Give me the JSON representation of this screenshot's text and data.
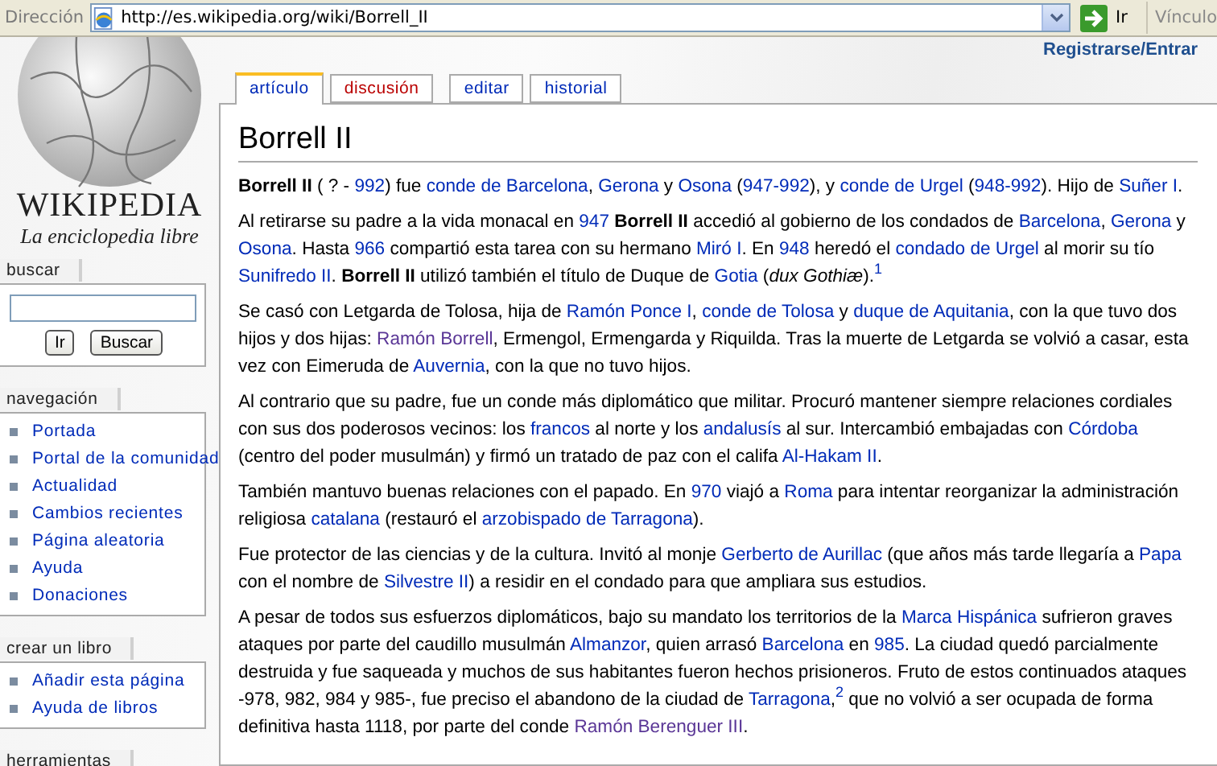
{
  "address_bar": {
    "label": "Dirección",
    "url": "http://es.wikipedia.org/wiki/Borrell_II",
    "go": "Ir",
    "links": "Vínculo"
  },
  "logo": {
    "wordmark": "WIKIPEDIA",
    "tagline": "La enciclopedia libre"
  },
  "user_link": "Registrarse/Entrar",
  "tabs": [
    {
      "label": "artículo",
      "selected": true,
      "missing": false
    },
    {
      "label": "discusión",
      "selected": false,
      "missing": true
    },
    {
      "label": "editar",
      "selected": false,
      "missing": false
    },
    {
      "label": "historial",
      "selected": false,
      "missing": false
    }
  ],
  "search": {
    "title": "buscar",
    "buttons": [
      "Ir",
      "Buscar"
    ]
  },
  "portlets": [
    {
      "title": "navegación",
      "items": [
        "Portada",
        "Portal de la comunidad",
        "Actualidad",
        "Cambios recientes",
        "Página aleatoria",
        "Ayuda",
        "Donaciones"
      ]
    },
    {
      "title": "crear un libro",
      "items": [
        "Añadir esta página",
        "Ayuda de libros"
      ]
    },
    {
      "title": "herramientas"
    }
  ],
  "article": {
    "title": "Borrell II",
    "paragraphs": [
      [
        {
          "kind": "bold",
          "text": "Borrell II"
        },
        {
          "kind": "text",
          "text": " ( ? - "
        },
        {
          "kind": "link",
          "text": "992"
        },
        {
          "kind": "text",
          "text": ") fue "
        },
        {
          "kind": "link",
          "text": "conde de Barcelona"
        },
        {
          "kind": "text",
          "text": ", "
        },
        {
          "kind": "link",
          "text": "Gerona"
        },
        {
          "kind": "text",
          "text": " y "
        },
        {
          "kind": "link",
          "text": "Osona"
        },
        {
          "kind": "text",
          "text": " ("
        },
        {
          "kind": "link",
          "text": "947-992"
        },
        {
          "kind": "text",
          "text": "), y "
        },
        {
          "kind": "link",
          "text": "conde de Urgel"
        },
        {
          "kind": "text",
          "text": " ("
        },
        {
          "kind": "link",
          "text": "948-992"
        },
        {
          "kind": "text",
          "text": "). Hijo de "
        },
        {
          "kind": "link",
          "text": "Suñer I"
        },
        {
          "kind": "text",
          "text": "."
        }
      ],
      [
        {
          "kind": "text",
          "text": "Al retirarse su padre a la vida monacal en "
        },
        {
          "kind": "link",
          "text": "947"
        },
        {
          "kind": "bold",
          "text": " Borrell II"
        },
        {
          "kind": "text",
          "text": " accedió al gobierno de los condados de "
        },
        {
          "kind": "link",
          "text": "Barcelona"
        },
        {
          "kind": "text",
          "text": ", "
        },
        {
          "kind": "link",
          "text": "Gerona"
        },
        {
          "kind": "text",
          "text": " y "
        },
        {
          "kind": "link",
          "text": "Osona"
        },
        {
          "kind": "text",
          "text": ". Hasta "
        },
        {
          "kind": "link",
          "text": "966"
        },
        {
          "kind": "text",
          "text": " compartió esta tarea con su hermano "
        },
        {
          "kind": "link",
          "text": "Miró I"
        },
        {
          "kind": "text",
          "text": ". En "
        },
        {
          "kind": "link",
          "text": "948"
        },
        {
          "kind": "text",
          "text": " heredó el "
        },
        {
          "kind": "link",
          "text": "condado de Urgel"
        },
        {
          "kind": "text",
          "text": " al morir su tío "
        },
        {
          "kind": "link",
          "text": "Sunifredo II"
        },
        {
          "kind": "text",
          "text": ". "
        },
        {
          "kind": "bold",
          "text": "Borrell II"
        },
        {
          "kind": "text",
          "text": " utilizó también el título de Duque de "
        },
        {
          "kind": "link",
          "text": "Gotia"
        },
        {
          "kind": "text",
          "text": " ("
        },
        {
          "kind": "italic",
          "text": "dux Gothiæ"
        },
        {
          "kind": "text",
          "text": ")."
        },
        {
          "kind": "note",
          "text": "1"
        }
      ],
      [
        {
          "kind": "text",
          "text": "Se casó con Letgarda de Tolosa, hija de "
        },
        {
          "kind": "link",
          "text": "Ramón Ponce I"
        },
        {
          "kind": "text",
          "text": ", "
        },
        {
          "kind": "link",
          "text": "conde de Tolosa"
        },
        {
          "kind": "text",
          "text": " y "
        },
        {
          "kind": "link",
          "text": "duque de Aquitania"
        },
        {
          "kind": "text",
          "text": ", con la que tuvo dos hijos y dos hijas: "
        },
        {
          "kind": "visited",
          "text": "Ramón Borrell"
        },
        {
          "kind": "text",
          "text": ", Ermengol, Ermengarda y Riquilda. Tras la muerte de Letgarda se volvió a casar, esta vez con Eimeruda de "
        },
        {
          "kind": "link",
          "text": "Auvernia"
        },
        {
          "kind": "text",
          "text": ", con la que no tuvo hijos."
        }
      ],
      [
        {
          "kind": "text",
          "text": "Al contrario que su padre, fue un conde más diplomático que militar. Procuró mantener siempre relaciones cordiales con sus dos poderosos vecinos: los "
        },
        {
          "kind": "link",
          "text": "francos"
        },
        {
          "kind": "text",
          "text": " al norte y los "
        },
        {
          "kind": "link",
          "text": "andalusís"
        },
        {
          "kind": "text",
          "text": " al sur. Intercambió embajadas con "
        },
        {
          "kind": "link",
          "text": "Córdoba"
        },
        {
          "kind": "text",
          "text": " (centro del poder musulmán) y firmó un tratado de paz con el califa "
        },
        {
          "kind": "link",
          "text": "Al-Hakam II"
        },
        {
          "kind": "text",
          "text": "."
        }
      ],
      [
        {
          "kind": "text",
          "text": "También mantuvo buenas relaciones con el papado. En "
        },
        {
          "kind": "link",
          "text": "970"
        },
        {
          "kind": "text",
          "text": " viajó a "
        },
        {
          "kind": "link",
          "text": "Roma"
        },
        {
          "kind": "text",
          "text": " para intentar reorganizar la administración religiosa "
        },
        {
          "kind": "link",
          "text": "catalana"
        },
        {
          "kind": "text",
          "text": " (restauró el "
        },
        {
          "kind": "link",
          "text": "arzobispado de Tarragona"
        },
        {
          "kind": "text",
          "text": ")."
        }
      ],
      [
        {
          "kind": "text",
          "text": "Fue protector de las ciencias y de la cultura. Invitó al monje "
        },
        {
          "kind": "link",
          "text": "Gerberto de Aurillac"
        },
        {
          "kind": "text",
          "text": " (que años más tarde llegaría a "
        },
        {
          "kind": "link",
          "text": "Papa"
        },
        {
          "kind": "text",
          "text": " con el nombre de "
        },
        {
          "kind": "link",
          "text": "Silvestre II"
        },
        {
          "kind": "text",
          "text": ") a residir en el condado para que ampliara sus estudios."
        }
      ],
      [
        {
          "kind": "text",
          "text": "A pesar de todos sus esfuerzos diplomáticos, bajo su mandato los territorios de la "
        },
        {
          "kind": "link",
          "text": "Marca Hispánica"
        },
        {
          "kind": "text",
          "text": " sufrieron graves ataques por parte del caudillo musulmán "
        },
        {
          "kind": "link",
          "text": "Almanzor"
        },
        {
          "kind": "text",
          "text": ", quien arrasó "
        },
        {
          "kind": "link",
          "text": "Barcelona"
        },
        {
          "kind": "text",
          "text": " en "
        },
        {
          "kind": "link",
          "text": "985"
        },
        {
          "kind": "text",
          "text": ". La ciudad quedó parcialmente destruida y fue saqueada y muchos de sus habitantes fueron hechos prisioneros. Fruto de estos continuados ataques -978, 982, 984 y 985-, fue preciso el abandono de la ciudad de "
        },
        {
          "kind": "link",
          "text": "Tarragona"
        },
        {
          "kind": "text",
          "text": ","
        },
        {
          "kind": "note",
          "text": "2"
        },
        {
          "kind": "text",
          "text": " que no volvió a ser ocupada de forma definitiva hasta 1118, por parte del conde "
        },
        {
          "kind": "visited",
          "text": "Ramón Berenguer III"
        },
        {
          "kind": "text",
          "text": "."
        }
      ]
    ]
  }
}
